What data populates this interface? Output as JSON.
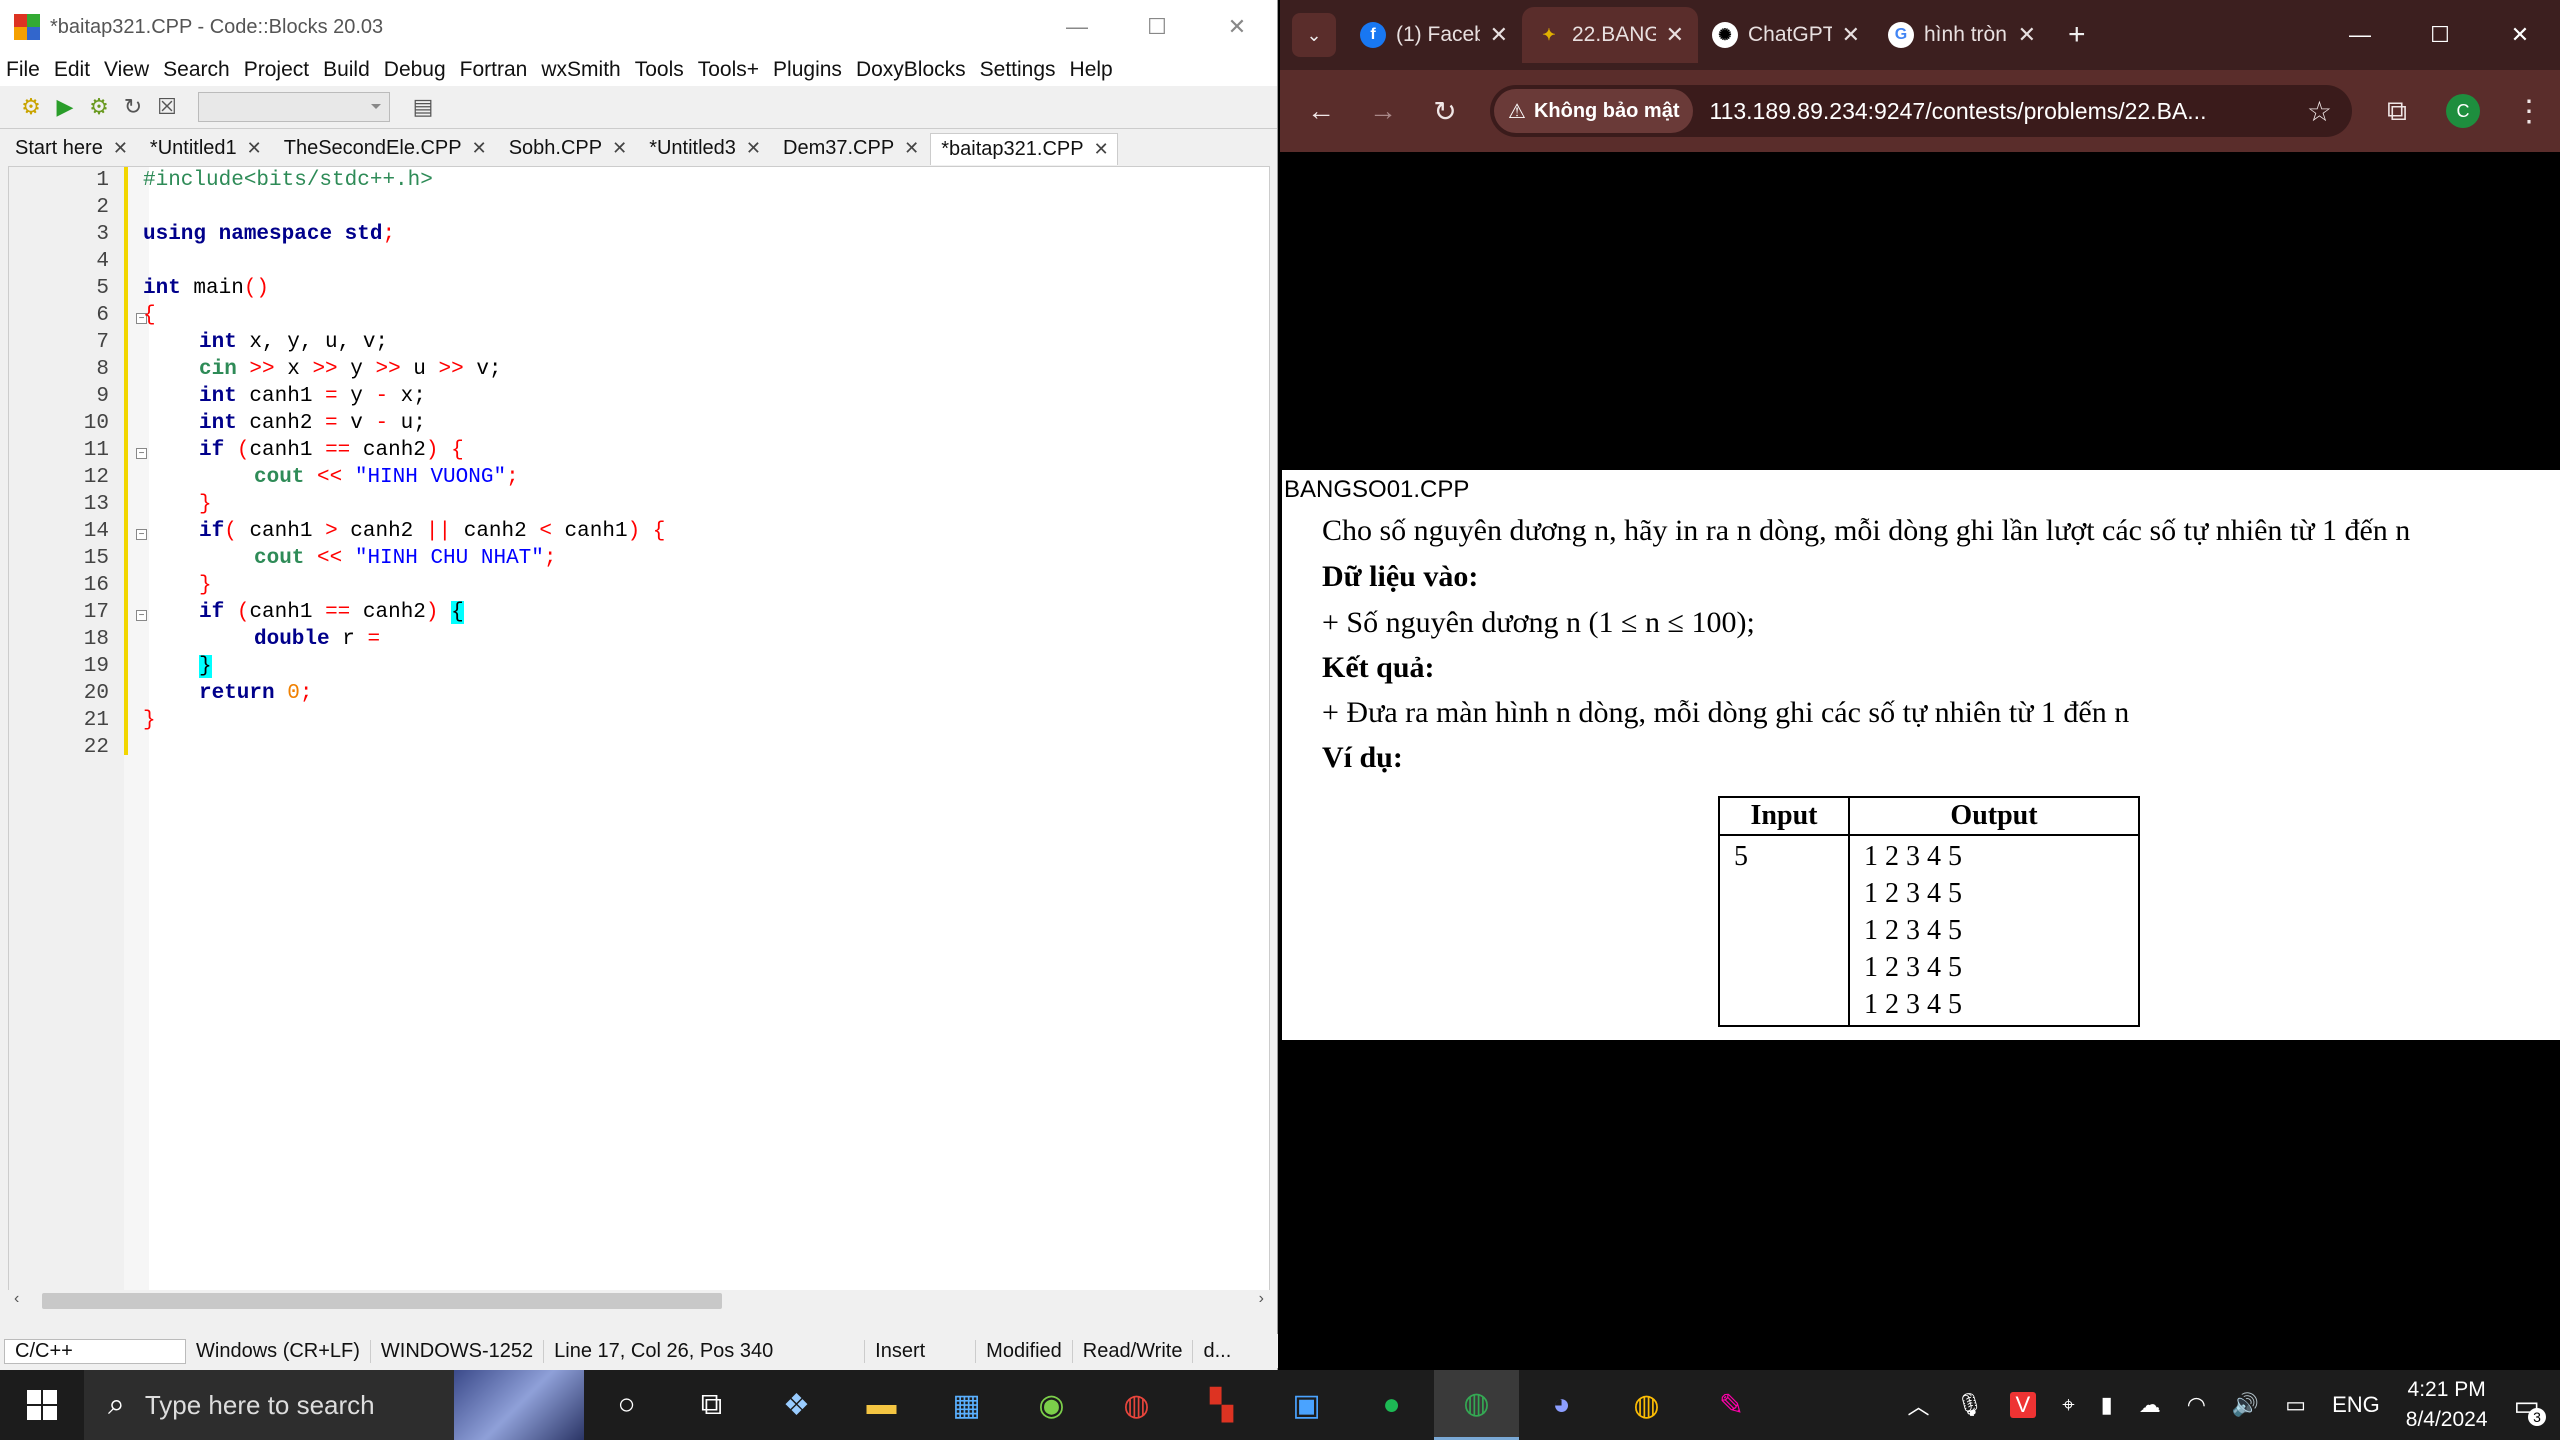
{
  "codeblocks": {
    "title": "*baitap321.CPP - Code::Blocks 20.03",
    "window_buttons": [
      "—",
      "☐",
      "✕"
    ],
    "menu": [
      "File",
      "Edit",
      "View",
      "Search",
      "Project",
      "Build",
      "Debug",
      "Fortran",
      "wxSmith",
      "Tools",
      "Tools+",
      "Plugins",
      "DoxyBlocks",
      "Settings",
      "Help"
    ],
    "tabs": [
      "Start here",
      "*Untitled1",
      "TheSecondEle.CPP",
      "Sobh.CPP",
      "*Untitled3",
      "Dem37.CPP",
      "*baitap321.CPP"
    ],
    "active_tab": 6,
    "line_numbers": [
      "1",
      "2",
      "3",
      "4",
      "5",
      "6",
      "7",
      "8",
      "9",
      "10",
      "11",
      "12",
      "13",
      "14",
      "15",
      "16",
      "17",
      "18",
      "19",
      "20",
      "21",
      "22"
    ],
    "code": {
      "l1": "#include<bits/stdc++.h>",
      "l3a": "using",
      "l3b": "namespace",
      "l3c": "std",
      "l3d": ";",
      "l5a": "int",
      "l5b": " main",
      "l5c": "()",
      "l6": "{",
      "l7a": "int",
      "l7b": " x, y, u, v;",
      "l8a": "cin",
      "l8b": " >> ",
      "l8c": "x",
      "l8d": " >> ",
      "l8e": "y",
      "l8f": " >> ",
      "l8g": "u",
      "l8h": " >> ",
      "l8i": "v;",
      "l9a": "int",
      "l9b": " canh1 ",
      "l9c": "=",
      "l9d": " y ",
      "l9e": "-",
      "l9f": " x;",
      "l10a": "int",
      "l10b": " canh2 ",
      "l10c": "=",
      "l10d": " v ",
      "l10e": "-",
      "l10f": " u;",
      "l11a": "if",
      "l11b": " (",
      "l11c": "canh1 ",
      "l11d": "==",
      "l11e": " canh2",
      "l11f": ") {",
      "l12a": "cout",
      "l12b": " << ",
      "l12c": "\"HINH VUONG\"",
      "l12d": ";",
      "l13": "}",
      "l14a": "if",
      "l14b": "( ",
      "l14c": "canh1 ",
      "l14d": ">",
      "l14e": " canh2 ",
      "l14f": "||",
      "l14g": " canh2 ",
      "l14h": "<",
      "l14i": " canh1",
      "l14j": ") {",
      "l15a": "cout",
      "l15b": " << ",
      "l15c": "\"HINH CHU NHAT\"",
      "l15d": ";",
      "l16": "}",
      "l17a": "if",
      "l17b": " (",
      "l17c": "canh1 ",
      "l17d": "==",
      "l17e": " canh2",
      "l17f": ") ",
      "l17g": "{",
      "l18a": "double",
      "l18b": " r ",
      "l18c": "=",
      "l19": "}",
      "l20a": "return",
      "l20b": " 0",
      "l20c": ";",
      "l21": "}"
    },
    "status": [
      "C/C++",
      "Windows (CR+LF)",
      "WINDOWS-1252",
      "Line 17, Col 26, Pos 340",
      "Insert",
      "Modified",
      "Read/Write",
      "d..."
    ]
  },
  "chrome": {
    "tabs": [
      {
        "label": "(1) Faceb",
        "icon": "facebook-icon"
      },
      {
        "label": "22.BANG",
        "icon": "contest-icon"
      },
      {
        "label": "ChatGPT",
        "icon": "chatgpt-icon"
      },
      {
        "label": "hình tròn",
        "icon": "google-icon"
      }
    ],
    "active_tab": 1,
    "security_label": "Không bảo mật",
    "url": "113.189.89.234:9247/contests/problems/22.BA...",
    "profile_initial": "C",
    "window_buttons": [
      "—",
      "☐",
      "✕"
    ]
  },
  "problem": {
    "file_title": "BANGSO01.CPP",
    "statement": "Cho số nguyên dương n, hãy in ra n dòng, mỗi dòng ghi lần lượt các số tự nhiên từ 1 đến n",
    "input_heading": "Dữ liệu vào:",
    "input_text": "+ Số nguyên dương n (1 ≤ n ≤ 100);",
    "output_heading": "Kết quả:",
    "output_text": "+ Đưa ra màn hình n dòng, mỗi dòng ghi các số tự nhiên từ 1 đến n",
    "example_heading": "Ví dụ:",
    "table_headers": [
      "Input",
      "Output"
    ],
    "example_input": "5",
    "example_output": [
      "1 2 3 4 5",
      "1 2 3 4 5",
      "1 2 3 4 5",
      "1 2 3 4 5",
      "1 2 3 4 5"
    ]
  },
  "taskbar": {
    "search_placeholder": "Type here to search",
    "language": "ENG",
    "time": "4:21 PM",
    "date": "8/4/2024",
    "notification_count": "3"
  }
}
